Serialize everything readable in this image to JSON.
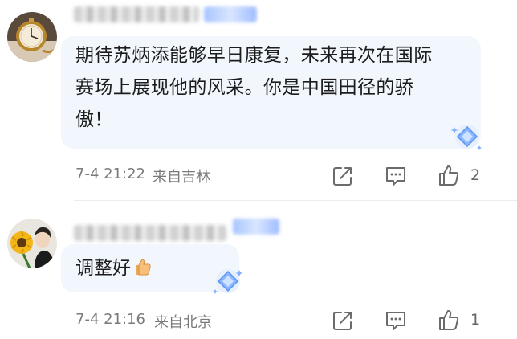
{
  "comments": [
    {
      "text_lines": [
        "期待苏炳添能够早日康复，未来再次在国际",
        "赛场上展现他的风采。你是中国田径的骄",
        "傲！"
      ],
      "time": "7-4 21:22",
      "location": "来自吉林",
      "likes": "2",
      "avatar_icon": "pocket-watch-avatar"
    },
    {
      "text": "调整好",
      "emoji_icon": "thumbs-up-emoji",
      "time": "7-4 21:16",
      "location": "来自北京",
      "likes": "1",
      "avatar_icon": "sunflower-person-avatar"
    }
  ],
  "colors": {
    "bubble": "#f2f6fd",
    "meta_text": "#7a7a7a",
    "icon_stroke": "#6b6b6b",
    "badge": "#a7c5ff"
  },
  "icons": [
    "share-icon",
    "reply-icon",
    "like-icon",
    "sparkle-diamond-icon"
  ]
}
